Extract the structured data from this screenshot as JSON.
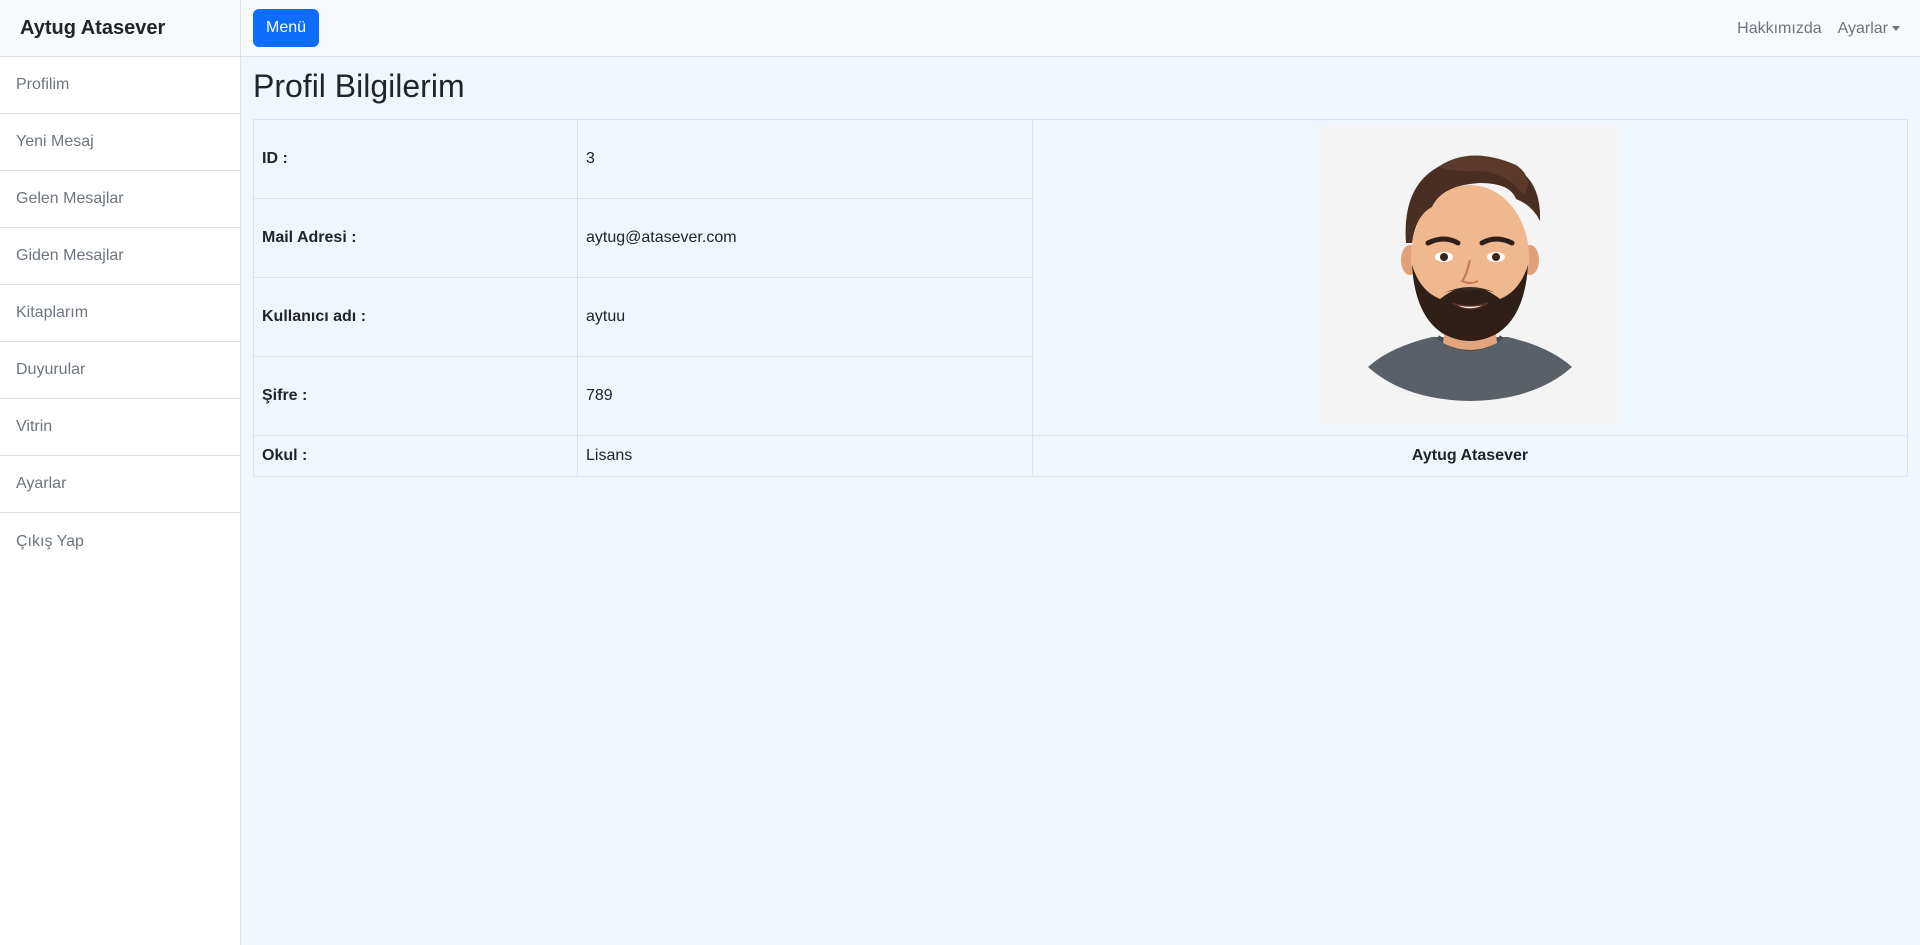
{
  "sidebar": {
    "title": "Aytug Atasever",
    "items": [
      {
        "label": "Profilim"
      },
      {
        "label": "Yeni Mesaj"
      },
      {
        "label": "Gelen Mesajlar"
      },
      {
        "label": "Giden Mesajlar"
      },
      {
        "label": "Kitaplarım"
      },
      {
        "label": "Duyurular"
      },
      {
        "label": "Vitrin"
      },
      {
        "label": "Ayarlar"
      },
      {
        "label": "Çıkış Yap"
      }
    ]
  },
  "navbar": {
    "menu_button": "Menü",
    "links": {
      "about": "Hakkımızda",
      "settings": "Ayarlar"
    }
  },
  "page": {
    "title": "Profil Bilgilerim"
  },
  "profile": {
    "rows": [
      {
        "label": "ID :",
        "value": "3"
      },
      {
        "label": "Mail Adresi :",
        "value": "aytug@atasever.com"
      },
      {
        "label": "Kullanıcı adı :",
        "value": "aytuu"
      },
      {
        "label": "Şifre :",
        "value": "789"
      },
      {
        "label": "Okul :",
        "value": "Lisans"
      }
    ],
    "name": "Aytug Atasever"
  },
  "colors": {
    "primary": "#0d6efd",
    "page_background": "#f0f6fe",
    "navbar_background": "#f8f9fa"
  }
}
